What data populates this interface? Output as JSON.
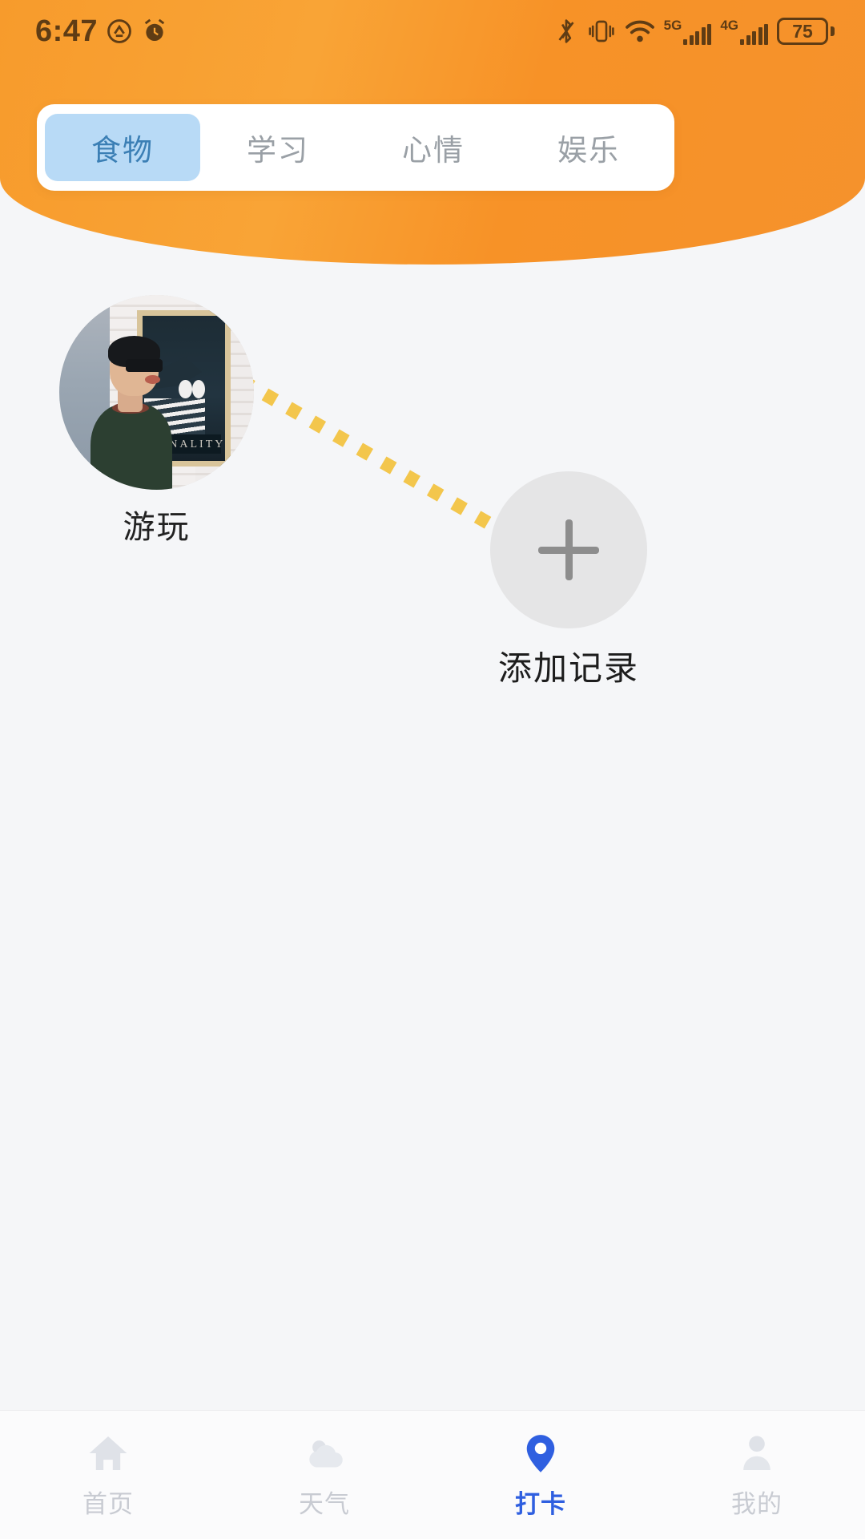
{
  "status_bar": {
    "time": "6:47",
    "left_icons": [
      "do-not-disturb-icon",
      "alarm-icon"
    ],
    "right_icons": [
      "bluetooth-off-icon",
      "vibrate-icon",
      "wifi-icon"
    ],
    "network_5g_label": "5G",
    "network_4g_label": "4G",
    "battery_level": "75"
  },
  "colors": {
    "header_orange": "#f79b2c",
    "tab_active_bg": "#b8daf6",
    "tab_active_text": "#3b7fb5",
    "tab_inactive_text": "#9aa0a6",
    "nav_active": "#2f5fe0",
    "nav_inactive": "#c8cbd2",
    "connector_dot": "#f3c64c",
    "add_button_bg": "#e5e5e6",
    "add_button_plus": "#8d8d8d",
    "page_bg": "#f5f6f8"
  },
  "tabs": [
    {
      "label": "食物",
      "active": true
    },
    {
      "label": "学习",
      "active": false
    },
    {
      "label": "心情",
      "active": false
    },
    {
      "label": "娱乐",
      "active": false
    }
  ],
  "canvas": {
    "record_node": {
      "label": "游玩",
      "image_alt": "person-in-cap-and-sunglasses-photo"
    },
    "add_node": {
      "label": "添加记录",
      "icon": "plus-icon"
    },
    "connector": {
      "style": "dotted",
      "from": "record_node",
      "to": "add_node"
    }
  },
  "bottom_nav": [
    {
      "label": "首页",
      "icon": "home-icon",
      "active": false
    },
    {
      "label": "天气",
      "icon": "cloud-icon",
      "active": false
    },
    {
      "label": "打卡",
      "icon": "map-pin-icon",
      "active": true
    },
    {
      "label": "我的",
      "icon": "person-icon",
      "active": false
    }
  ]
}
